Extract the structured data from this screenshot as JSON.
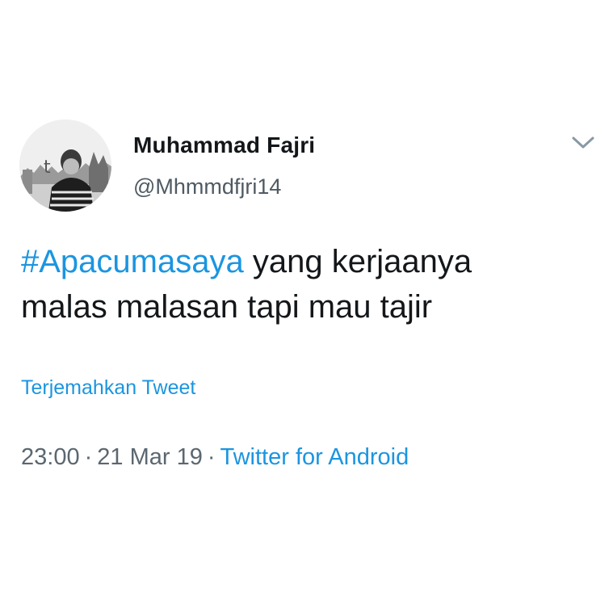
{
  "tweet": {
    "author": {
      "display_name": "Muhammad Fajri",
      "handle": "@Mhmmdfjri14",
      "avatar_icon": "profile-photo"
    },
    "menu_icon": "chevron-down-icon",
    "text": {
      "hashtag": "#Apacumasaya",
      "line1_rest": " yang kerjaanya",
      "line2": "malas malasan tapi mau tajir"
    },
    "translate_label": "Terjemahkan Tweet",
    "meta": {
      "time": "23:00",
      "separator": "·",
      "date": "21 Mar 19",
      "source": "Twitter for Android"
    }
  },
  "colors": {
    "link": "#1b95e0",
    "text": "#14171a",
    "secondary": "#5b6770",
    "background": "#ffffff"
  }
}
